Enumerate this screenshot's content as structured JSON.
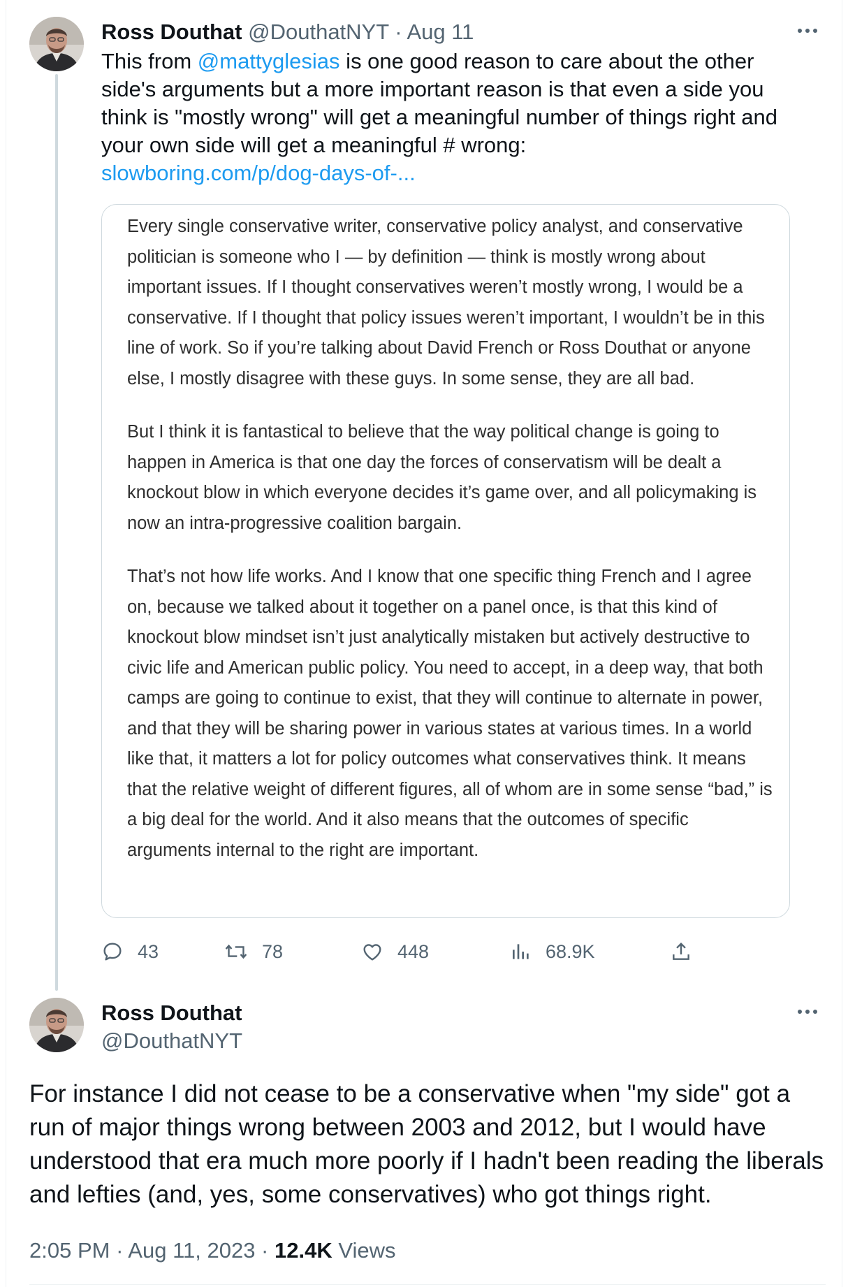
{
  "tweet": {
    "author_name": "Ross Douthat",
    "handle": "@DouthatNYT",
    "date_sep": " · ",
    "date": "Aug 11",
    "text_before_mention": "This from ",
    "mention": "@mattyglesias",
    "text_after_mention": " is one good reason to care about the other side's arguments but a more important reason is that even a side you think is \"mostly wrong\" will get a meaningful number of things right and your own side will get a meaningful # wrong:",
    "link": "slowboring.com/p/dog-days-of-...",
    "more_icon": "more-horizontal-icon"
  },
  "quote_image": {
    "paragraphs": [
      "Every single conservative writer, conservative policy analyst, and conservative politician is someone who I — by definition — think is mostly wrong about important issues. If I thought conservatives weren’t mostly wrong, I would be a conservative. If I thought that policy issues weren’t important, I wouldn’t be in this line of work. So if you’re talking about David French or Ross Douthat or anyone else, I mostly disagree with these guys. In some sense, they are all bad.",
      "But I think it is fantastical to believe that the way political change is going to happen in America is that one day the forces of conservatism will be dealt a knockout blow in which everyone decides it’s game over, and all policymaking is now an intra-progressive coalition bargain.",
      "That’s not how life works. And I know that one specific thing French and I agree on, because we talked about it together on a panel once, is that this kind of knockout blow mindset isn’t just analytically mistaken but actively destructive to civic life and American public policy. You need to accept, in a deep way, that both camps are going to continue to exist, that they will continue to alternate in power, and that they will be sharing power in various states at various times. In a world like that, it matters a lot for policy outcomes what conservatives think. It means that the relative weight of different figures, all of whom are in some sense “bad,” is a big deal for the world. And it also means that the outcomes of specific arguments internal to the right are important."
    ]
  },
  "actions": {
    "replies": "43",
    "reposts": "78",
    "likes": "448",
    "views": "68.9K",
    "icons": [
      "reply-icon",
      "repost-icon",
      "like-icon",
      "views-icon",
      "share-icon"
    ]
  },
  "reply_tweet": {
    "author_name": "Ross Douthat",
    "handle": "@DouthatNYT",
    "text": "For instance I did not cease to be a conservative when \"my side\" got a run of major things wrong between 2003 and 2012, but I would have understood that era much more poorly if I hadn't been reading the liberals and lefties (and, yes, some conservatives) who got things right.",
    "time": "2:05 PM",
    "date": "Aug 11, 2023",
    "sep": " · ",
    "views_count": "12.4K",
    "views_label": " Views"
  },
  "colors": {
    "text": "#0f1419",
    "muted": "#536471",
    "link": "#1d9bf0",
    "border": "#cfd9de"
  }
}
